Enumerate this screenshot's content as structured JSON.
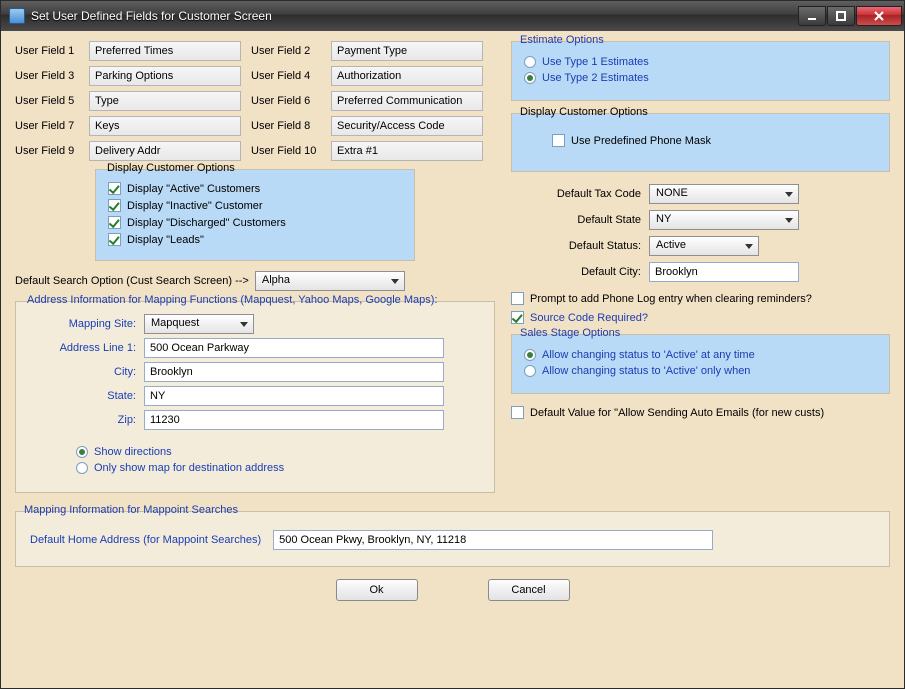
{
  "window": {
    "title": "Set User Defined Fields for Customer Screen"
  },
  "user_fields": {
    "labels": [
      "User Field 1",
      "User Field 2",
      "User Field 3",
      "User Field 4",
      "User Field 5",
      "User Field 6",
      "User Field 7",
      "User Field 8",
      "User Field 9",
      "User Field 10"
    ],
    "values": [
      "Preferred Times",
      "Payment Type",
      "Parking Options",
      "Authorization",
      "Type",
      "Preferred Communication",
      "Keys",
      "Security/Access Code",
      "Delivery Addr",
      "Extra #1"
    ]
  },
  "display_customer_options": {
    "legend": "Display Customer Options",
    "items": [
      {
        "label": "Display \"Active\" Customers",
        "checked": true
      },
      {
        "label": "Display \"Inactive\" Customer",
        "checked": true
      },
      {
        "label": "Display \"Discharged\" Customers",
        "checked": true
      },
      {
        "label": "Display \"Leads\"",
        "checked": true
      }
    ]
  },
  "search": {
    "label": "Default Search Option (Cust Search Screen) -->",
    "value": "Alpha"
  },
  "mapping": {
    "legend": "Address Information for Mapping Functions (Mapquest, Yahoo Maps, Google Maps):",
    "site_label": "Mapping Site:",
    "site_value": "Mapquest",
    "addr1_label": "Address Line 1:",
    "addr1_value": "500 Ocean Parkway",
    "city_label": "City:",
    "city_value": "Brooklyn",
    "state_label": "State:",
    "state_value": "NY",
    "zip_label": "Zip:",
    "zip_value": "11230",
    "opt_show_directions": "Show directions",
    "opt_only_map": "Only show map for destination address"
  },
  "estimate": {
    "legend": "Estimate Options",
    "opt1": "Use Type 1 Estimates",
    "opt2": "Use Type 2 Estimates"
  },
  "phone_mask_group": {
    "legend": "Display Customer Options",
    "label": "Use Predefined Phone Mask"
  },
  "defaults": {
    "tax_label": "Default Tax Code",
    "tax_value": "NONE",
    "state_label": "Default State",
    "state_value": "NY",
    "status_label": "Default Status:",
    "status_value": "Active",
    "city_label": "Default City:",
    "city_value": "Brooklyn"
  },
  "misc": {
    "prompt_phone_log": "Prompt to add Phone Log entry when clearing reminders?",
    "source_required": "Source Code Required?",
    "sales_legend": "Sales Stage Options",
    "sales_opt1": "Allow changing status to 'Active' at any time",
    "sales_opt2": "Allow changing status to 'Active' only when",
    "auto_email": "Default Value for \"Allow Sending Auto Emails (for new custs)"
  },
  "mappoint": {
    "legend": "Mapping Information for Mappoint Searches",
    "label": "Default Home Address (for Mappoint Searches)",
    "value": "500 Ocean Pkwy, Brooklyn, NY, 11218"
  },
  "buttons": {
    "ok": "Ok",
    "cancel": "Cancel"
  }
}
